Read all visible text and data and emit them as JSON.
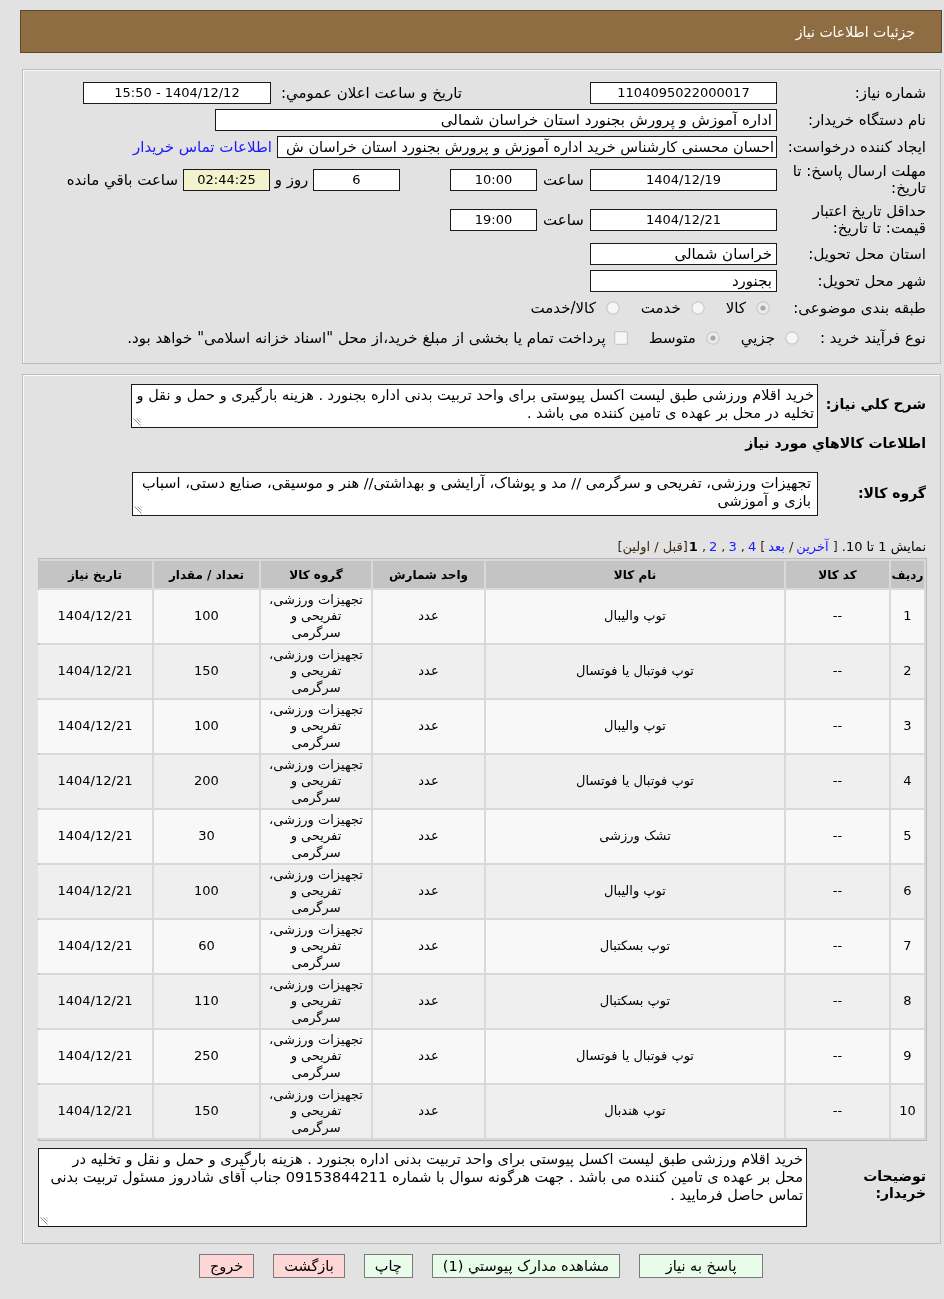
{
  "header": {
    "title": "جزئیات اطلاعات نیاز"
  },
  "details": {
    "need_number": {
      "label": "شماره نیاز:",
      "value": "1104095022000017"
    },
    "announcement": {
      "label": "تاریخ و ساعت اعلان عمومي:",
      "value": "1404/12/12 - 15:50"
    },
    "buyer_organization": {
      "label": "نام دستگاه خریدار:",
      "value": "اداره آموزش و پرورش بجنورد استان خراسان شمالی"
    },
    "requester": {
      "label": "ایجاد کننده درخواست:",
      "value": "احسان محسنی کارشناس خرید اداره آموزش و پرورش بجنورد استان خراسان ش",
      "contact_link": "اطلاعات تماس خریدار"
    },
    "response_deadline": {
      "label": "مهلت ارسال پاسخ: تا تاریخ:",
      "date": "1404/12/19",
      "time_label": "ساعت",
      "time": "10:00",
      "days": "6",
      "days_label": "روز و",
      "remaining": "02:44:25",
      "remaining_label": "ساعت باقي مانده"
    },
    "price_validity": {
      "label": "حداقل تاریخ اعتبار قیمت: تا تاریخ:",
      "date": "1404/12/21",
      "time_label": "ساعت",
      "time": "19:00"
    },
    "delivery_province": {
      "label": "استان محل تحویل:",
      "value": "خراسان شمالی"
    },
    "delivery_city": {
      "label": "شهر محل تحویل:",
      "value": "بجنورد"
    },
    "subject_category": {
      "label": "طبقه بندی موضوعی:",
      "options": [
        {
          "label": "کالا",
          "selected": true
        },
        {
          "label": "خدمت",
          "selected": false
        },
        {
          "label": "کالا/خدمت",
          "selected": false
        }
      ]
    },
    "purchase_process": {
      "label": "نوع فرآیند خرید :",
      "options": [
        {
          "label": "جزيي",
          "selected": false
        },
        {
          "label": "متوسط",
          "selected": true
        }
      ],
      "treasury_payment": {
        "label": "پرداخت تمام یا بخشی از مبلغ خرید،از محل \"اسناد خزانه اسلامی\" خواهد بود.",
        "checked": false
      }
    }
  },
  "items": {
    "summary": {
      "label": "شرح کلي نیاز:",
      "value": "خرید اقلام ورزشی طبق لیست اکسل پیوستی برای واحد تربیت بدنی اداره بجنورد . هزینه بارگیری و حمل و نقل و تخلیه در محل بر عهده ی تامین کننده می باشد ."
    },
    "heading": "اطلاعات کالاهاي مورد نیاز",
    "goods_group": {
      "label": "گروه کالا:",
      "value": "تجهیزات ورزشی، تفریحی و سرگرمی // مد و پوشاک، آرایشی و بهداشتی// هنر و موسیقی، صنایع دستی، اسباب بازی و آموزشی"
    },
    "pager": {
      "summary": "نمایش 1 تا 10.",
      "parts": [
        {
          "kind": "text",
          "text": "["
        },
        {
          "kind": "link",
          "text": "آخرین"
        },
        {
          "kind": "text",
          "text": "/"
        },
        {
          "kind": "link",
          "text": "بعد"
        },
        {
          "kind": "text",
          "text": "]"
        },
        {
          "kind": "link",
          "text": "4"
        },
        {
          "kind": "text",
          "text": ","
        },
        {
          "kind": "link",
          "text": "3"
        },
        {
          "kind": "text",
          "text": ","
        },
        {
          "kind": "link",
          "text": "2"
        },
        {
          "kind": "text",
          "text": ","
        },
        {
          "kind": "current",
          "text": "1"
        },
        {
          "kind": "text",
          "text": "[قبل / اولین]"
        }
      ]
    },
    "table": {
      "columns": [
        "ردیف",
        "کد کالا",
        "نام کالا",
        "واحد شمارش",
        "گروه کالا",
        "تعداد / مقدار",
        "تاریخ نیاز"
      ],
      "rows": [
        [
          "1",
          "--",
          "توپ والیبال",
          "عدد",
          "تجهیزات ورزشی، تفریحی و سرگرمی",
          "100",
          "1404/12/21"
        ],
        [
          "2",
          "--",
          "توپ فوتبال یا فوتسال",
          "عدد",
          "تجهیزات ورزشی، تفریحی و سرگرمی",
          "150",
          "1404/12/21"
        ],
        [
          "3",
          "--",
          "توپ والیبال",
          "عدد",
          "تجهیزات ورزشی، تفریحی و سرگرمی",
          "100",
          "1404/12/21"
        ],
        [
          "4",
          "--",
          "توپ فوتبال یا فوتسال",
          "عدد",
          "تجهیزات ورزشی، تفریحی و سرگرمی",
          "200",
          "1404/12/21"
        ],
        [
          "5",
          "--",
          "تشک ورزشی",
          "عدد",
          "تجهیزات ورزشی، تفریحی و سرگرمی",
          "30",
          "1404/12/21"
        ],
        [
          "6",
          "--",
          "توپ والیبال",
          "عدد",
          "تجهیزات ورزشی، تفریحی و سرگرمی",
          "100",
          "1404/12/21"
        ],
        [
          "7",
          "--",
          "توپ بسکتبال",
          "عدد",
          "تجهیزات ورزشی، تفریحی و سرگرمی",
          "60",
          "1404/12/21"
        ],
        [
          "8",
          "--",
          "توپ بسکتبال",
          "عدد",
          "تجهیزات ورزشی، تفریحی و سرگرمی",
          "110",
          "1404/12/21"
        ],
        [
          "9",
          "--",
          "توپ فوتبال یا فوتسال",
          "عدد",
          "تجهیزات ورزشی، تفریحی و سرگرمی",
          "250",
          "1404/12/21"
        ],
        [
          "10",
          "--",
          "توپ هندبال",
          "عدد",
          "تجهیزات ورزشی، تفریحی و سرگرمی",
          "150",
          "1404/12/21"
        ]
      ]
    },
    "buyer_notes": {
      "label": "توضیحات خریدار:",
      "value": "خرید اقلام ورزشی طبق لیست اکسل پیوستی برای واحد تربیت بدنی اداره بجنورد . هزینه بارگیری و حمل و نقل و تخلیه در محل بر عهده ی تامین کننده می باشد . جهت هرگونه سوال با شماره 09153844211 جناب آقای شادروز مسئول تربیت بدنی تماس حاصل فرمایید ."
    }
  },
  "buttons": [
    {
      "label": "پاسخ به نیاز",
      "kind": "action"
    },
    {
      "label": "مشاهده مدارک پیوستي (1)",
      "kind": "action"
    },
    {
      "label": "چاپ",
      "kind": "action"
    },
    {
      "label": "بازگشت",
      "kind": "exit"
    },
    {
      "label": "خروج",
      "kind": "exit"
    }
  ]
}
